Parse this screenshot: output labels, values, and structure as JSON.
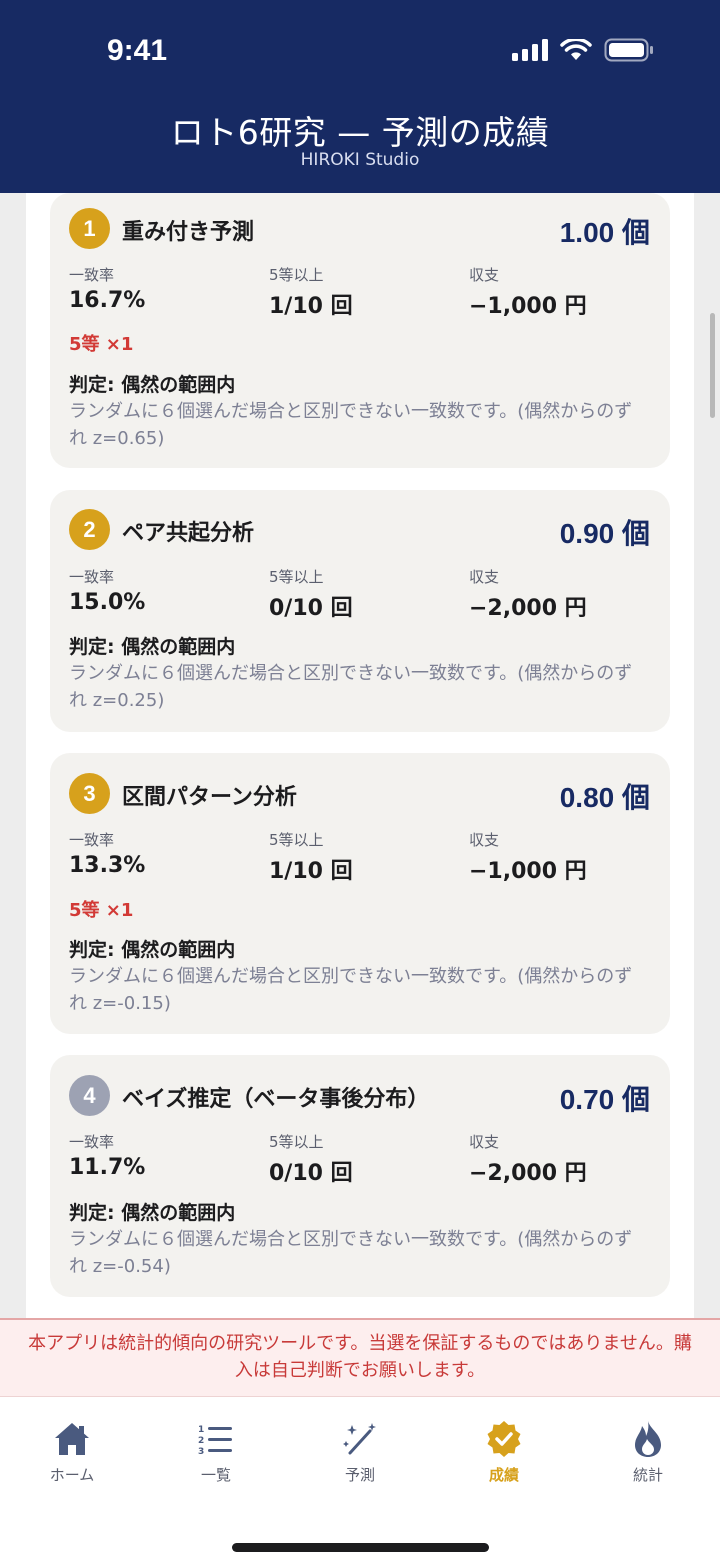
{
  "status_bar": {
    "time": "9:41"
  },
  "header": {
    "title": "ロト6研究 — 予測の成績",
    "subtitle": "HIROKI Studio"
  },
  "labels": {
    "match_rate": "一致率",
    "fifth_or_better": "5等以上",
    "balance": "収支"
  },
  "cards": [
    {
      "rank": "1",
      "badge_color": "#d7a11c",
      "name": "重み付き予測",
      "count": "1.00 個",
      "match_rate": "16.7%",
      "fifth_or_better": "1/10 回",
      "balance": "−1,000 円",
      "prize_note": "5等 ×1",
      "verdict": "判定: 偶然の範囲内",
      "verdict_desc": "ランダムに６個選んだ場合と区別できない一致数です。(偶然からのずれ z=0.65)"
    },
    {
      "rank": "2",
      "badge_color": "#d7a11c",
      "name": "ペア共起分析",
      "count": "0.90 個",
      "match_rate": "15.0%",
      "fifth_or_better": "0/10 回",
      "balance": "−2,000 円",
      "prize_note": "",
      "verdict": "判定: 偶然の範囲内",
      "verdict_desc": "ランダムに６個選んだ場合と区別できない一致数です。(偶然からのずれ z=0.25)"
    },
    {
      "rank": "3",
      "badge_color": "#d7a11c",
      "name": "区間パターン分析",
      "count": "0.80 個",
      "match_rate": "13.3%",
      "fifth_or_better": "1/10 回",
      "balance": "−1,000 円",
      "prize_note": "5等 ×1",
      "verdict": "判定: 偶然の範囲内",
      "verdict_desc": "ランダムに６個選んだ場合と区別できない一致数です。(偶然からのずれ z=-0.15)"
    },
    {
      "rank": "4",
      "badge_color": "#9da2b3",
      "name": "ベイズ推定（ベータ事後分布）",
      "count": "0.70 個",
      "match_rate": "11.7%",
      "fifth_or_better": "0/10 回",
      "balance": "−2,000 円",
      "prize_note": "",
      "verdict": "判定: 偶然の範囲内",
      "verdict_desc": "ランダムに６個選んだ場合と区別できない一致数です。(偶然からのずれ z=-0.54)"
    }
  ],
  "disclaimer": "本アプリは統計的傾向の研究ツールです。当選を保証するものではありません。購入は自己判断でお願いします。",
  "tabs": [
    {
      "label": "ホーム",
      "icon": "house-icon",
      "active": false
    },
    {
      "label": "一覧",
      "icon": "numbered-list-icon",
      "active": false
    },
    {
      "label": "予測",
      "icon": "magic-wand-icon",
      "active": false
    },
    {
      "label": "成績",
      "icon": "check-seal-icon",
      "active": true
    },
    {
      "label": "統計",
      "icon": "flame-icon",
      "active": false
    }
  ],
  "colors": {
    "header_bg": "#172a63",
    "accent_gold": "#d7a11c",
    "warning_red": "#d23a36"
  }
}
